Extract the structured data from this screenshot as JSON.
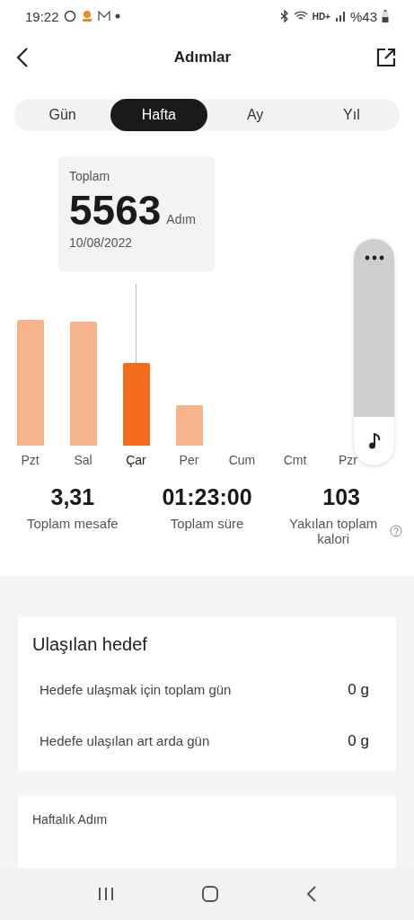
{
  "status_bar": {
    "time": "19:22",
    "network": "HD+",
    "battery": "%43"
  },
  "header": {
    "title": "Adımlar"
  },
  "tabs": [
    {
      "label": "Gün",
      "selected": false
    },
    {
      "label": "Hafta",
      "selected": true
    },
    {
      "label": "Ay",
      "selected": false
    },
    {
      "label": "Yıl",
      "selected": false
    }
  ],
  "tooltip": {
    "label": "Toplam",
    "value": "5563",
    "unit": "Adım",
    "date": "10/08/2022"
  },
  "days": [
    {
      "label": "Pzt",
      "selected": false
    },
    {
      "label": "Sal",
      "selected": false
    },
    {
      "label": "Çar",
      "selected": true
    },
    {
      "label": "Per",
      "selected": false
    },
    {
      "label": "Cum",
      "selected": false
    },
    {
      "label": "Cmt",
      "selected": false
    },
    {
      "label": "Pzr",
      "selected": false
    }
  ],
  "stats": [
    {
      "value": "3,31",
      "label": "Toplam mesafe"
    },
    {
      "value": "01:23:00",
      "label": "Toplam süre"
    },
    {
      "value": "103",
      "label": "Yakılan toplam kalori",
      "help": true
    }
  ],
  "goal_card": {
    "title": "Ulaşılan hedef",
    "rows": [
      {
        "label": "Hedefe ulaşmak için toplam gün",
        "value": "0 g"
      },
      {
        "label": "Hedefe ulaşılan art arda gün",
        "value": "0 g"
      }
    ]
  },
  "weekly_card": {
    "title": "Haftalık Adım"
  }
}
